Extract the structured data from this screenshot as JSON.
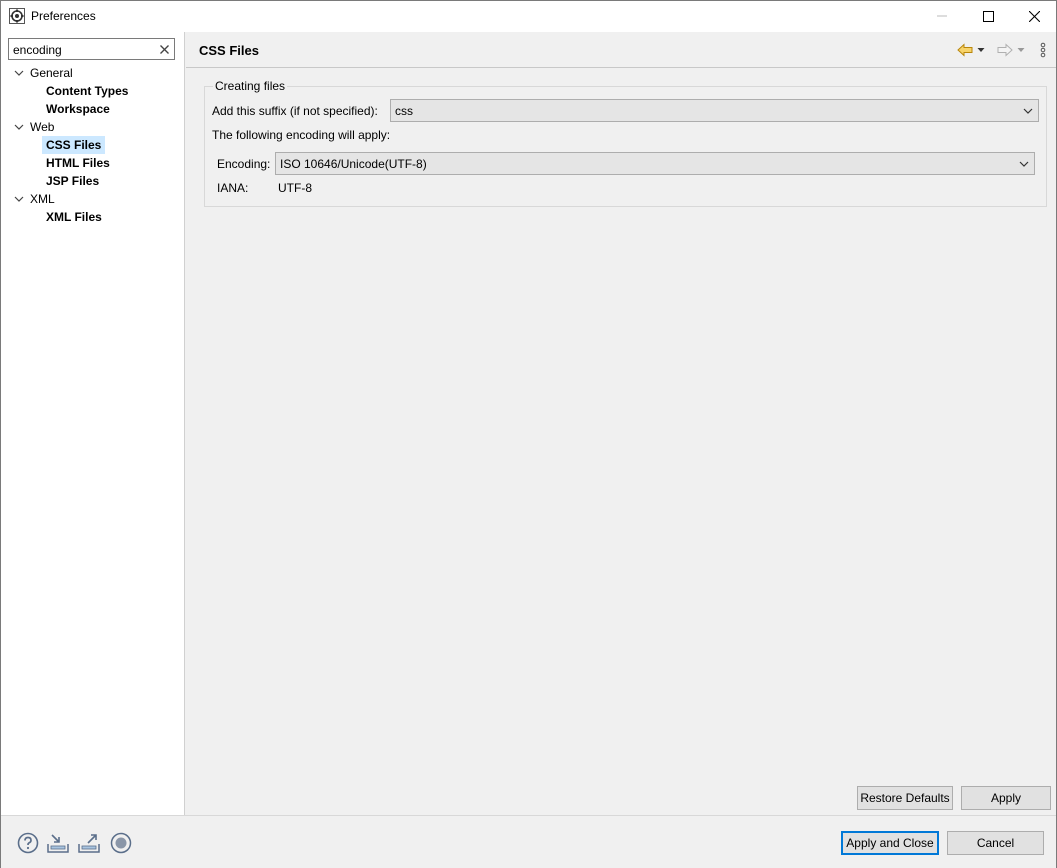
{
  "window": {
    "title": "Preferences",
    "icon": "eclipse-preferences-icon"
  },
  "filter": {
    "value": "encoding",
    "clear_icon": "clear-icon"
  },
  "tree": {
    "items": [
      {
        "label": "General",
        "type": "parent",
        "expanded": true
      },
      {
        "label": "Content Types",
        "type": "child"
      },
      {
        "label": "Workspace",
        "type": "child"
      },
      {
        "label": "Web",
        "type": "parent",
        "expanded": true
      },
      {
        "label": "CSS Files",
        "type": "child",
        "selected": true
      },
      {
        "label": "HTML Files",
        "type": "child"
      },
      {
        "label": "JSP Files",
        "type": "child"
      },
      {
        "label": "XML",
        "type": "parent",
        "expanded": true
      },
      {
        "label": "XML Files",
        "type": "child"
      }
    ]
  },
  "page": {
    "title": "CSS Files",
    "nav_icons": [
      "back-arrow-icon",
      "back-dropdown-icon",
      "forward-arrow-icon",
      "forward-dropdown-icon",
      "view-menu-icon"
    ],
    "group": {
      "legend": "Creating files",
      "suffix_label": "Add this suffix (if not specified):",
      "suffix_value": "css",
      "encoding_note": "The following encoding will apply:",
      "encoding_label": "Encoding:",
      "encoding_value": "ISO 10646/Unicode(UTF-8)",
      "iana_label": "IANA:",
      "iana_value": "UTF-8"
    },
    "restore_defaults_label": "Restore Defaults",
    "apply_label": "Apply"
  },
  "footer": {
    "icons": [
      "help-icon",
      "import-icon",
      "export-icon",
      "record-icon"
    ],
    "apply_close_label": "Apply and Close",
    "cancel_label": "Cancel"
  },
  "colors": {
    "selection": "#cce8ff",
    "default_button_border": "#0078d7",
    "back_arrow": "#d4a017"
  }
}
